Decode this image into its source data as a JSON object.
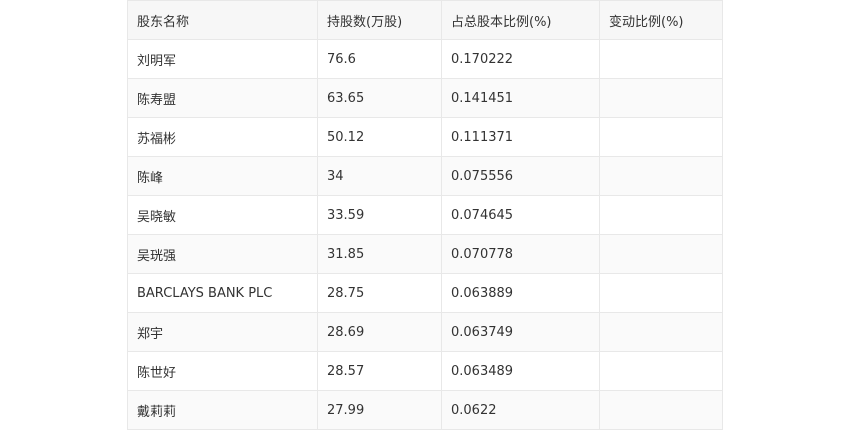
{
  "table": {
    "headers": [
      "股东名称",
      "持股数(万股)",
      "占总股本比例(%)",
      "变动比例(%)"
    ],
    "rows": [
      [
        "刘明军",
        "76.6",
        "0.170222",
        ""
      ],
      [
        "陈寿盟",
        "63.65",
        "0.141451",
        ""
      ],
      [
        "苏福彬",
        "50.12",
        "0.111371",
        ""
      ],
      [
        "陈峰",
        "34",
        "0.075556",
        ""
      ],
      [
        "吴晓敏",
        "33.59",
        "0.074645",
        ""
      ],
      [
        "吴珖强",
        "31.85",
        "0.070778",
        ""
      ],
      [
        "BARCLAYS BANK PLC",
        "28.75",
        "0.063889",
        ""
      ],
      [
        "郑宇",
        "28.69",
        "0.063749",
        ""
      ],
      [
        "陈世好",
        "28.57",
        "0.063489",
        ""
      ],
      [
        "戴莉莉",
        "27.99",
        "0.0622",
        ""
      ]
    ]
  }
}
